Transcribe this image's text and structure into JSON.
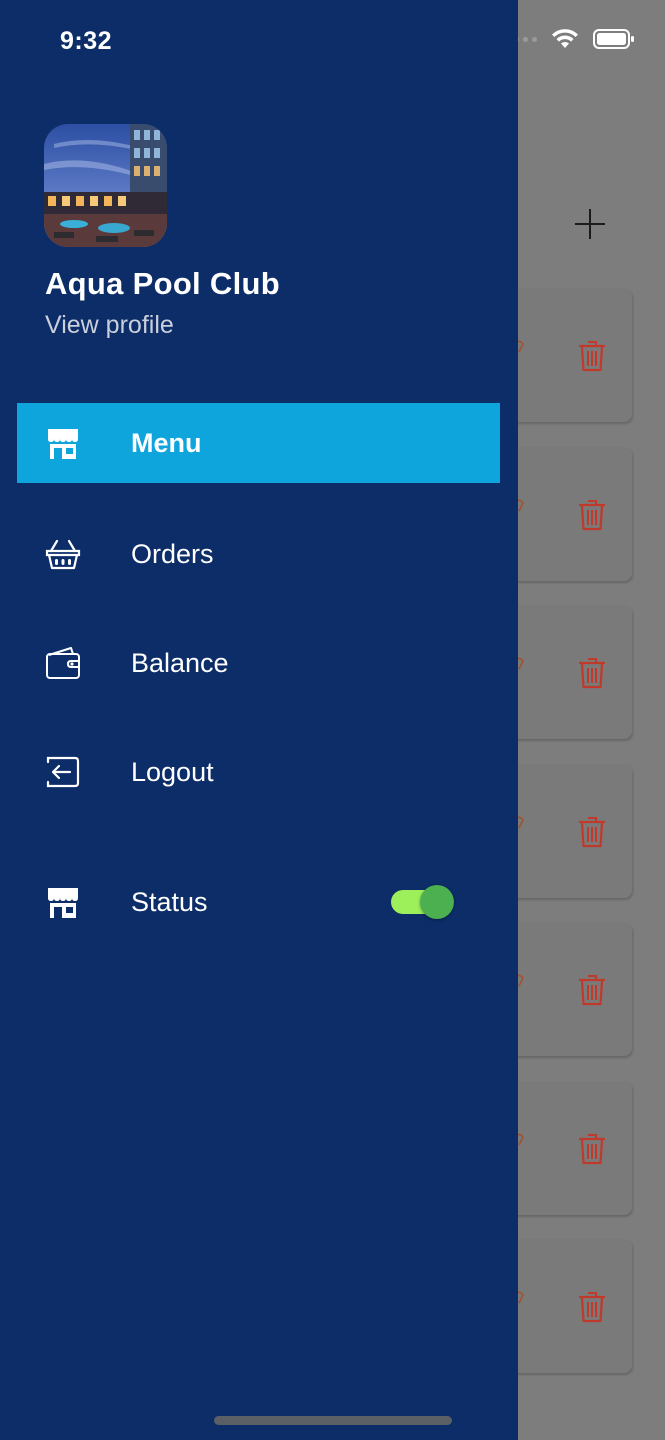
{
  "status_bar": {
    "time": "9:32"
  },
  "profile": {
    "name": "Aqua Pool Club",
    "view_profile": "View profile",
    "avatar": "pool-club-photo"
  },
  "nav": {
    "items": [
      {
        "label": "Menu",
        "icon": "store-icon",
        "active": true
      },
      {
        "label": "Orders",
        "icon": "basket-icon",
        "active": false
      },
      {
        "label": "Balance",
        "icon": "wallet-icon",
        "active": false
      },
      {
        "label": "Logout",
        "icon": "logout-icon",
        "active": false
      }
    ],
    "status": {
      "label": "Status",
      "icon": "store-icon",
      "enabled": true
    }
  },
  "colors": {
    "drawer_bg": "#0c2d68",
    "active_item": "#0ea5dc",
    "toggle_track": "#9ef05a",
    "toggle_knob": "#4caf50",
    "trash_icon": "#c0392b"
  },
  "background": {
    "add_icon": "plus-icon",
    "card_count": 7
  }
}
